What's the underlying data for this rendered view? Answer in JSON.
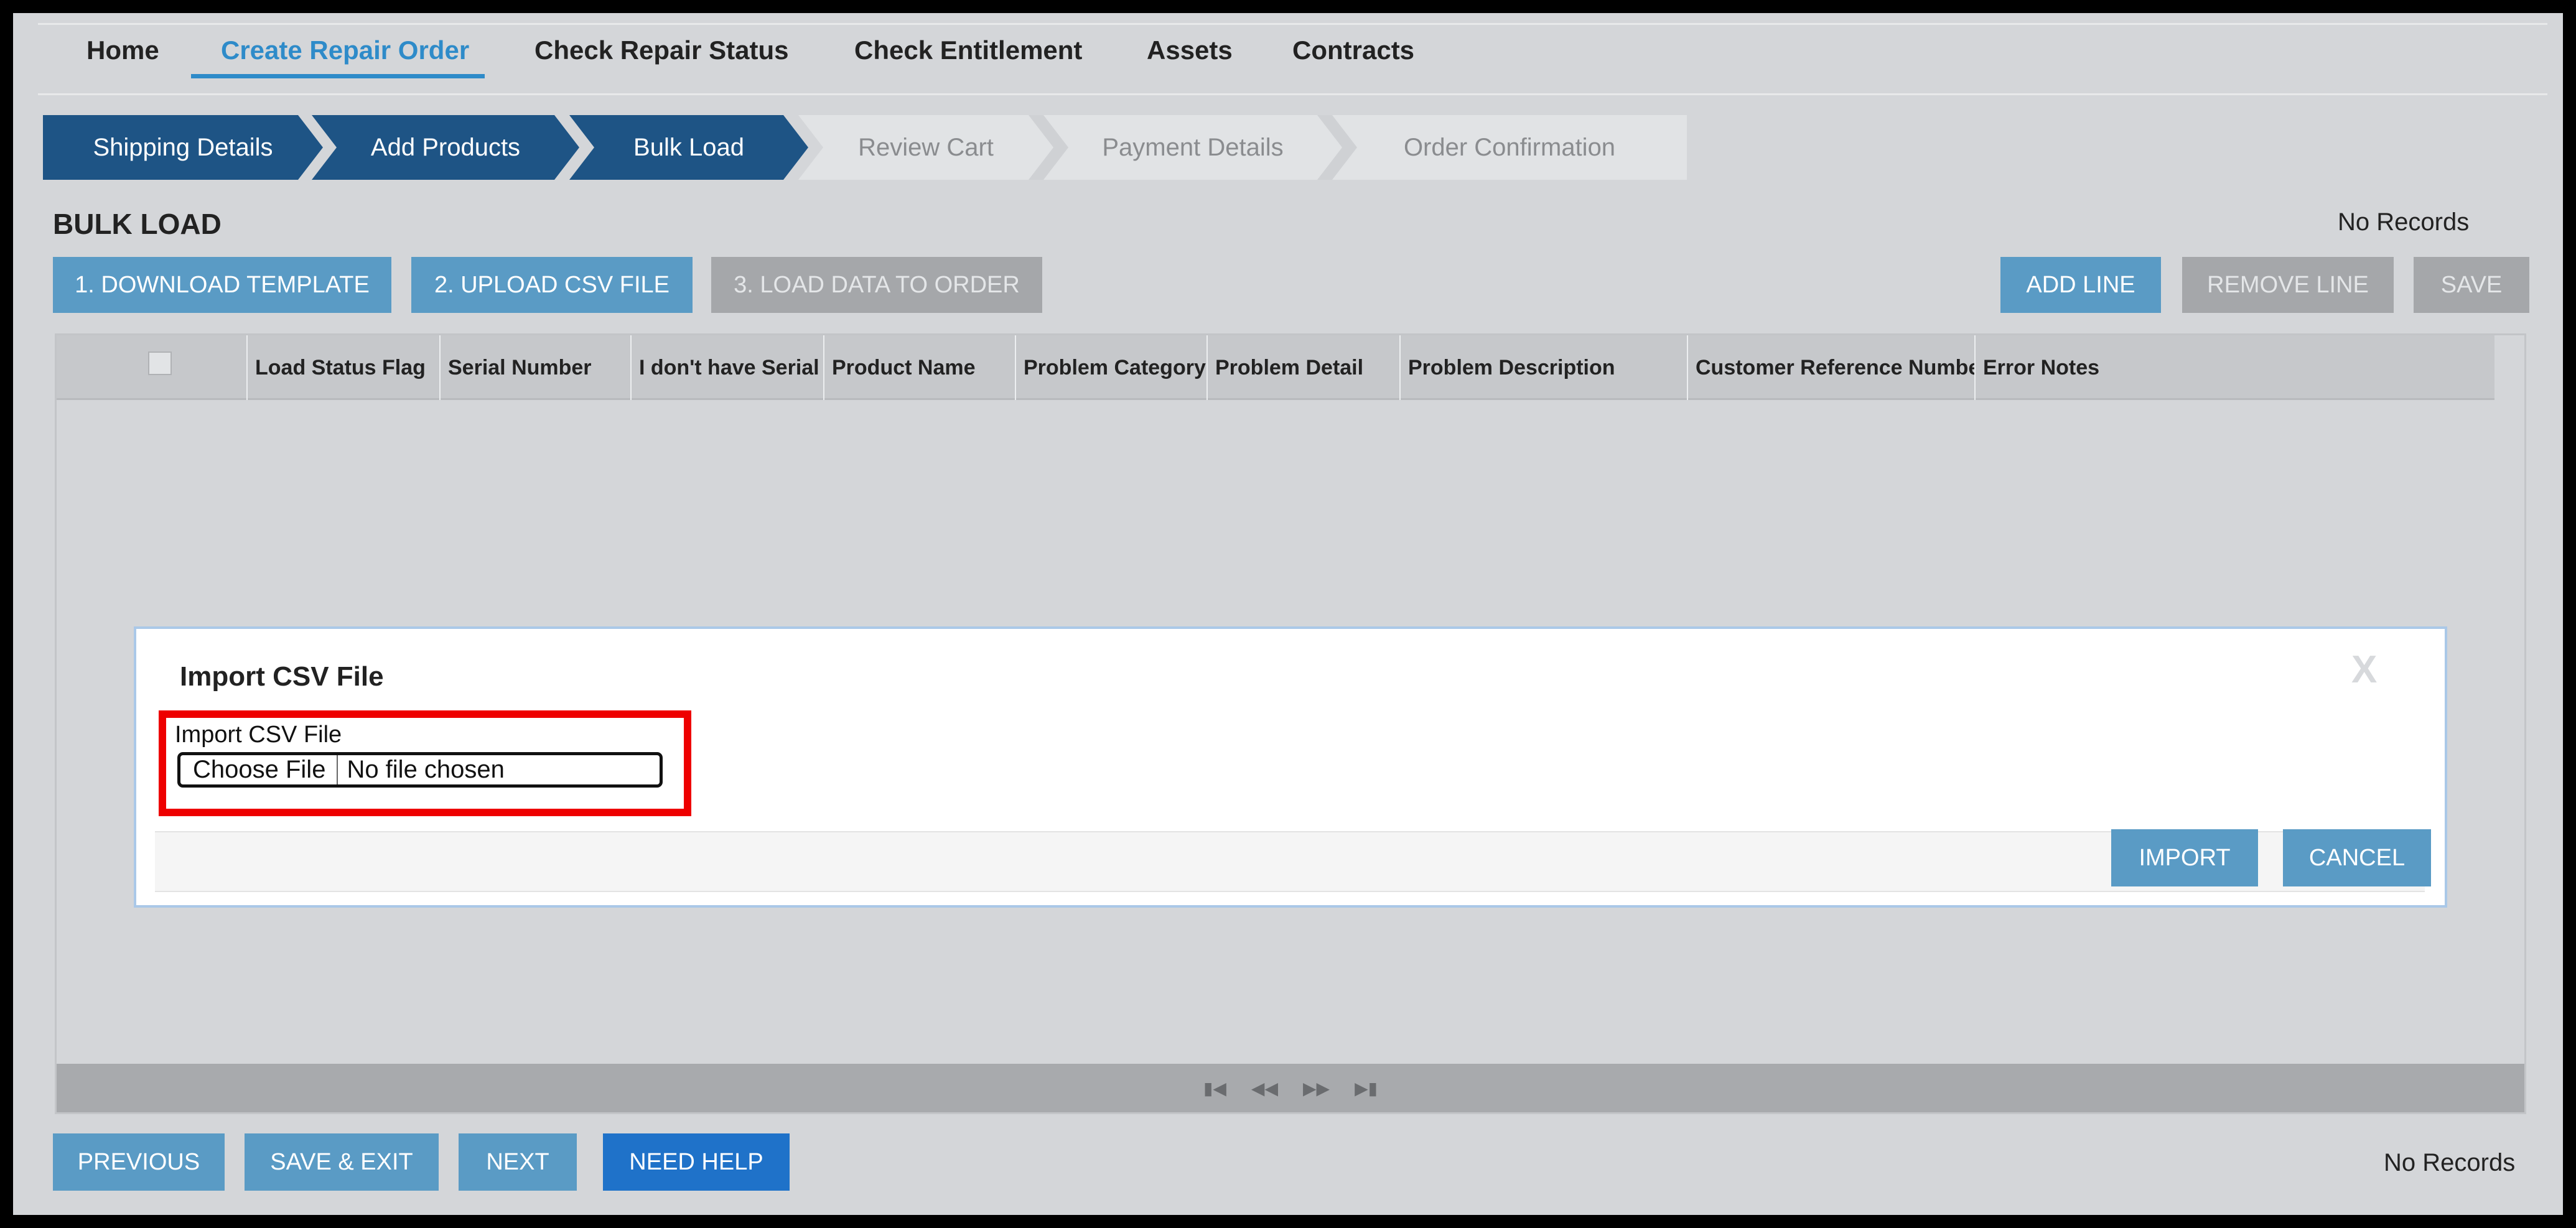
{
  "nav": {
    "items": [
      "Home",
      "Create Repair Order",
      "Check Repair Status",
      "Check Entitlement",
      "Assets",
      "Contracts"
    ],
    "active": "Create Repair Order"
  },
  "wizard": {
    "steps": [
      {
        "label": "Shipping Details",
        "state": "done"
      },
      {
        "label": "Add Products",
        "state": "done"
      },
      {
        "label": "Bulk Load",
        "state": "current"
      },
      {
        "label": "Review Cart",
        "state": "todo"
      },
      {
        "label": "Payment Details",
        "state": "todo"
      },
      {
        "label": "Order Confirmation",
        "state": "todo"
      }
    ]
  },
  "page": {
    "title": "BULK LOAD",
    "records_top": "No Records",
    "records_bottom": "No Records"
  },
  "toolbar": {
    "download_label": "1. DOWNLOAD TEMPLATE",
    "upload_label": "2. UPLOAD CSV FILE",
    "load_label": "3. LOAD DATA TO ORDER",
    "add_line_label": "ADD LINE",
    "remove_line_label": "REMOVE LINE",
    "save_label": "SAVE"
  },
  "grid": {
    "columns": [
      "Load Status Flag",
      "Serial Number",
      "I don't have Serial",
      "Product Name",
      "Problem Category",
      "Problem Detail",
      "Problem Description",
      "Customer Reference Number",
      "Error Notes"
    ],
    "rows": [],
    "pager_icons": [
      "first-page-icon",
      "prev-page-icon",
      "next-page-icon",
      "last-page-icon"
    ]
  },
  "modal": {
    "title": "Import CSV File",
    "close_glyph": "X",
    "field_label": "Import CSV File",
    "choose_button": "Choose File",
    "file_status": "No file chosen",
    "import_label": "IMPORT",
    "cancel_label": "CANCEL"
  },
  "footer": {
    "previous_label": "PREVIOUS",
    "save_exit_label": "SAVE & EXIT",
    "next_label": "NEXT",
    "help_label": "NEED HELP"
  },
  "colors": {
    "accent": "#2e8bc9",
    "step_done": "#1e5485",
    "button_blue": "#5a9bc5",
    "button_disabled": "#a5a7aa",
    "help_button": "#1f72c9",
    "highlight": "#ee0000"
  }
}
